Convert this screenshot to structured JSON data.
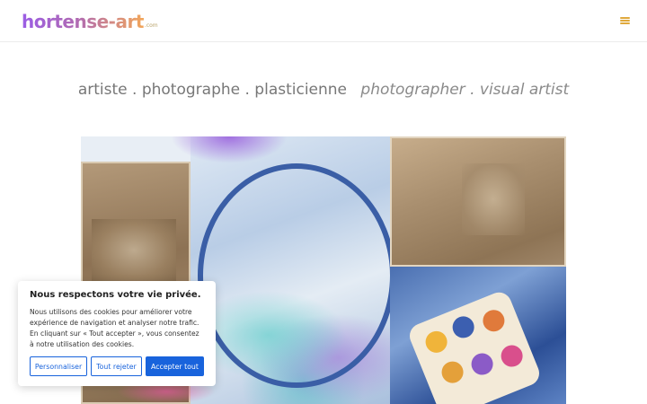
{
  "header": {
    "logo_text": "hortense-art",
    "logo_domain": ".com",
    "menu_icon": "hamburger-menu-icon",
    "accent_color": "#e0a93c"
  },
  "tagline": {
    "fr": "artiste . photographe . plasticienne",
    "en": "photographer . visual artist"
  },
  "hero": {
    "image_description_icon": "artwork-collage-image"
  },
  "cookie_banner": {
    "title": "Nous respectons votre vie privée.",
    "text": "Nous utilisons des cookies pour améliorer votre expérience de navigation et analyser notre trafic. En cliquant sur « Tout accepter », vous consentez à notre utilisation des cookies.",
    "customize_label": "Personnaliser",
    "reject_label": "Tout rejeter",
    "accept_label": "Accepter tout",
    "button_color": "#1863dc"
  }
}
